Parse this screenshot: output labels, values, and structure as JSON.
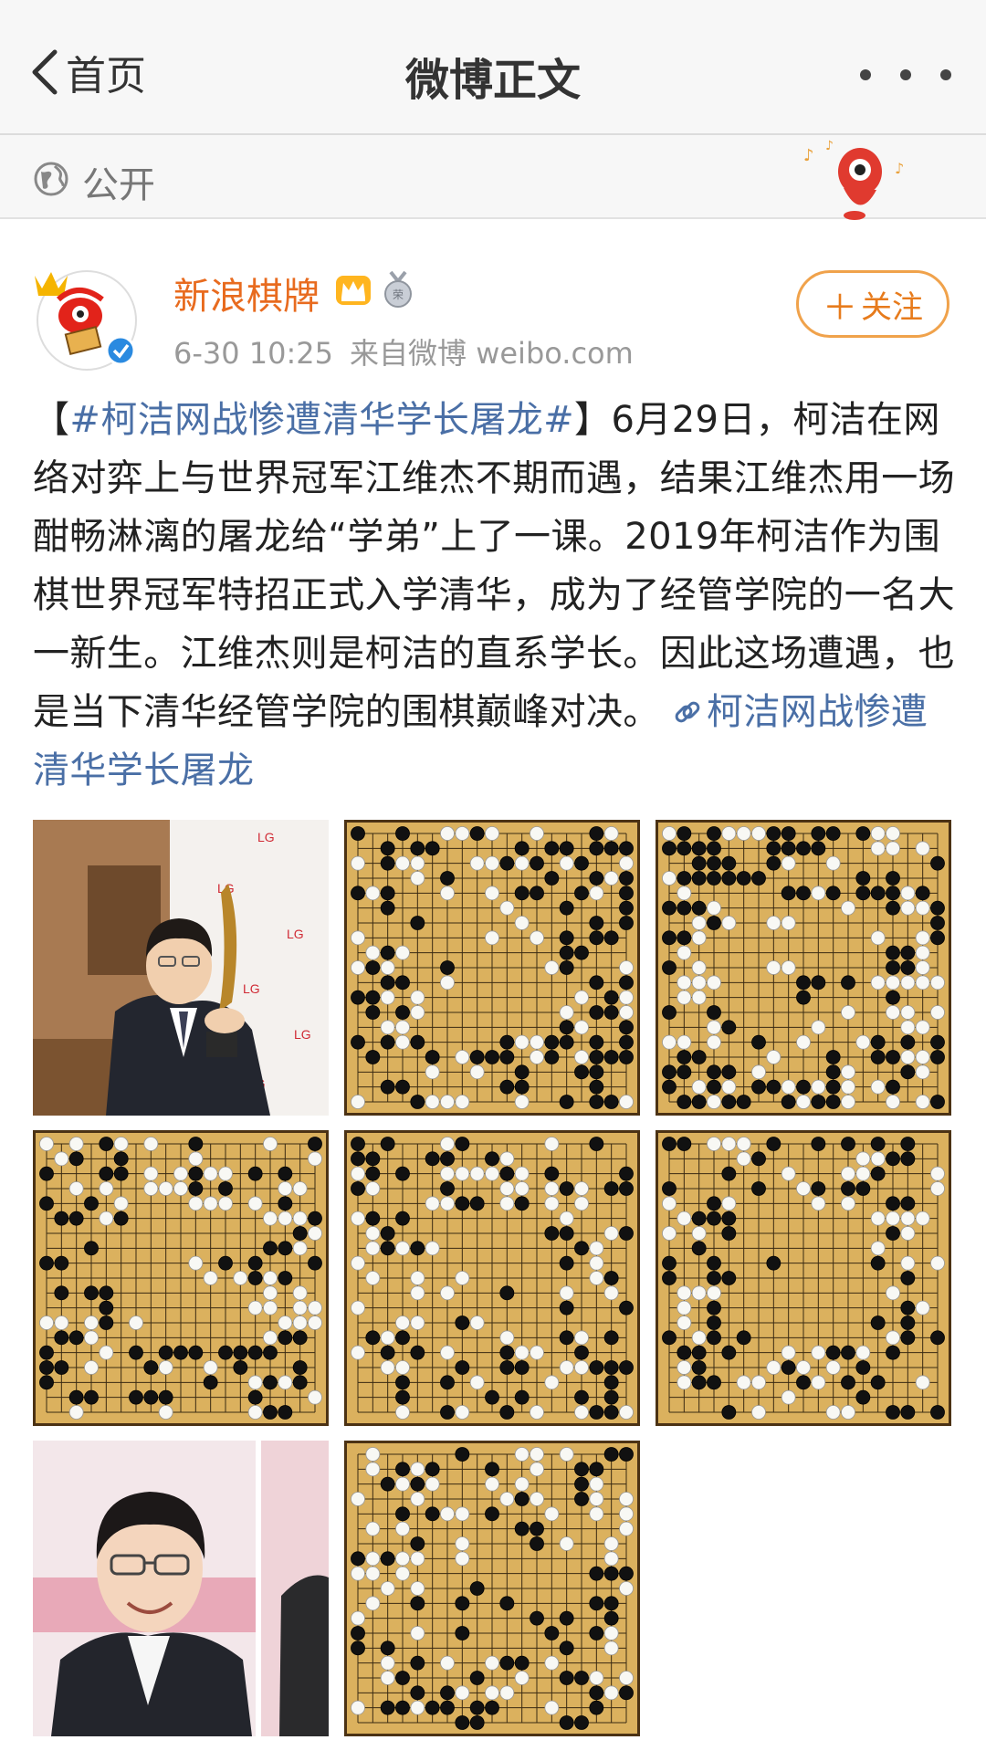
{
  "nav": {
    "back_label": "首页",
    "title": "微博正文"
  },
  "visibility": {
    "label": "公开"
  },
  "author": {
    "name": "新浪棋牌",
    "time": "6-30 10:25",
    "source": "来自微博 weibo.com",
    "follow_label": "关注",
    "follow_plus": "＋"
  },
  "post": {
    "bracket_open": "【",
    "hashtag": "#柯洁网战惨遭清华学长屠龙#",
    "bracket_close": "】",
    "body": "6月29日，柯洁在网络对弈上与世界冠军江维杰不期而遇，结果江维杰用一场酣畅淋漓的屠龙给“学弟”上了一课。2019年柯洁作为围棋世界冠军特招正式入学清华，成为了经管学院的一名大一新生。江维杰则是柯洁的直系学长。因此这场遭遇，也是当下清华经管学院的围棋巅峰对决。",
    "link_text": "柯洁网战惨遭清华学长屠龙"
  },
  "images": [
    {
      "kind": "photo",
      "name": "player-trophy-photo"
    },
    {
      "kind": "board",
      "name": "go-board-1"
    },
    {
      "kind": "board",
      "name": "go-board-2"
    },
    {
      "kind": "board",
      "name": "go-board-3"
    },
    {
      "kind": "board",
      "name": "go-board-4"
    },
    {
      "kind": "board",
      "name": "go-board-5"
    },
    {
      "kind": "photo",
      "name": "player-portrait-photo"
    },
    {
      "kind": "board",
      "name": "go-board-6"
    }
  ],
  "colors": {
    "accent_orange": "#e86b1f",
    "link_blue": "#4a6fa6",
    "board": "#dbb15e"
  },
  "icons": [
    "chevron-left-icon",
    "more-dots-icon",
    "globe-icon",
    "mascot-icon",
    "crown-icon",
    "medal-icon",
    "verified-icon",
    "link-icon"
  ]
}
